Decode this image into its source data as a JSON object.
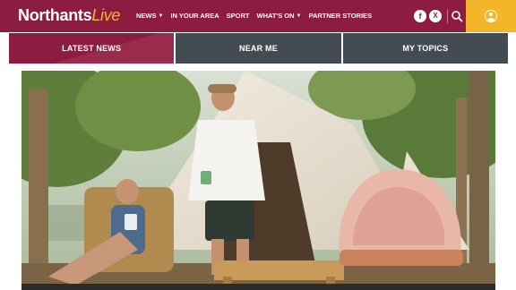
{
  "brand": {
    "name": "Northants",
    "suffix": "Live"
  },
  "nav": [
    {
      "label": "NEWS",
      "has_dropdown": true
    },
    {
      "label": "IN YOUR AREA",
      "has_dropdown": false
    },
    {
      "label": "SPORT",
      "has_dropdown": false
    },
    {
      "label": "WHAT'S ON",
      "has_dropdown": true
    },
    {
      "label": "PARTNER STORIES",
      "has_dropdown": false
    }
  ],
  "social": {
    "facebook": "f",
    "x": "X"
  },
  "tabs": [
    {
      "label": "LATEST NEWS",
      "active": true
    },
    {
      "label": "NEAR ME",
      "active": false
    },
    {
      "label": "MY TOPICS",
      "active": false
    }
  ],
  "colors": {
    "brand": "#8c1d40",
    "accent": "#f3b629",
    "tab_inactive": "#444b52"
  },
  "icons": {
    "search": "search-icon",
    "account": "user-icon",
    "dropdown": "chevron-down-icon"
  },
  "hero": {
    "image": "couple-glamping-bell-tent-photo"
  }
}
